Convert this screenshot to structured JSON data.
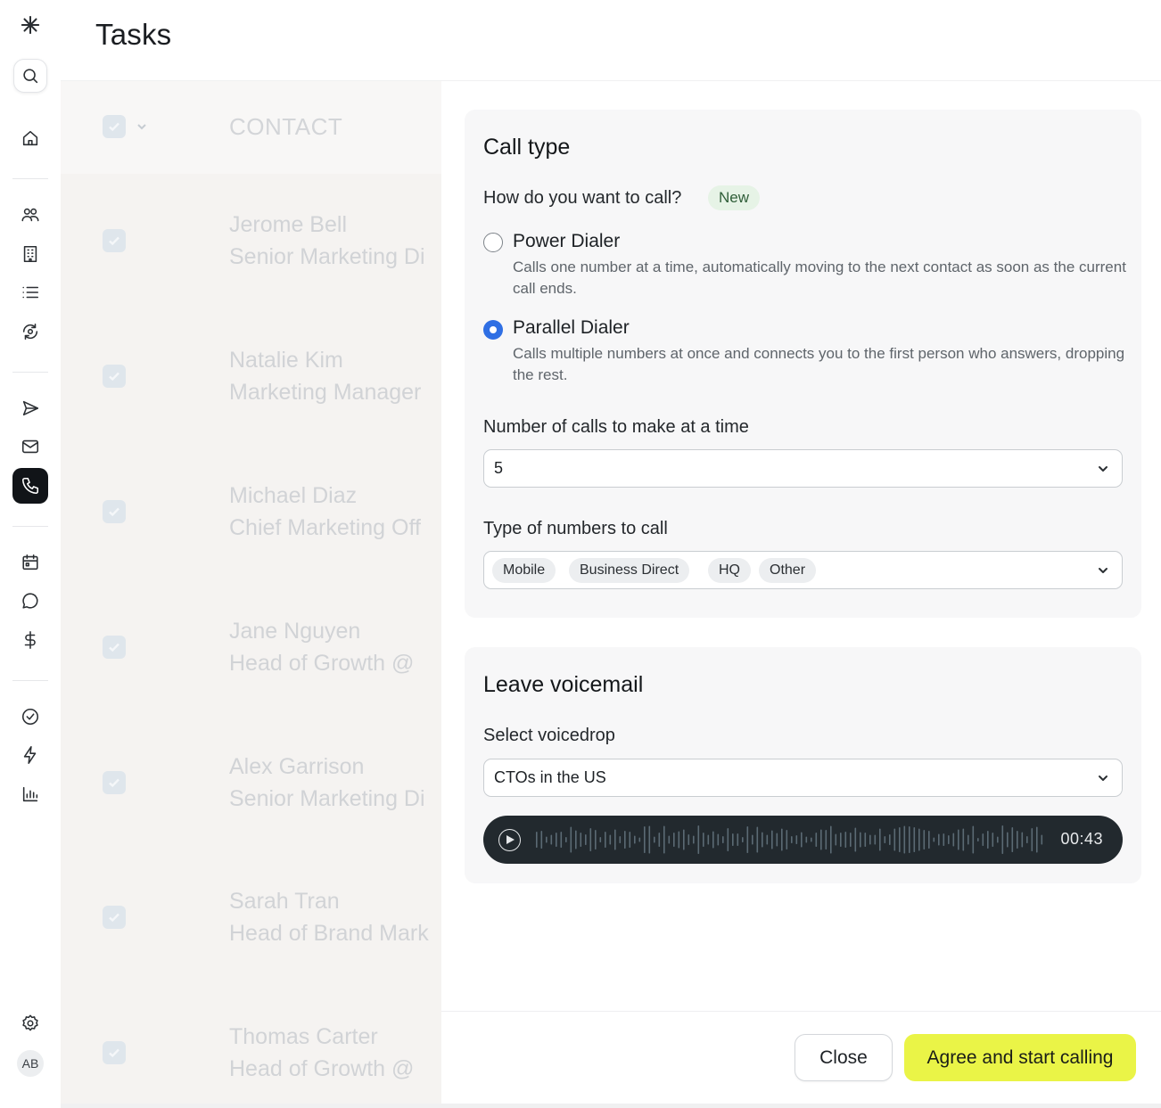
{
  "app": {
    "logo_icon": "asterisk-logo-icon"
  },
  "header": {
    "title": "Tasks"
  },
  "sidebar": {
    "user_initials": "AB",
    "items": [
      {
        "icon": "search-icon"
      },
      {
        "icon": "home-icon"
      },
      {
        "icon": "people-icon"
      },
      {
        "icon": "building-icon"
      },
      {
        "icon": "list-icon"
      },
      {
        "icon": "refresh-eye-icon"
      },
      {
        "icon": "send-icon"
      },
      {
        "icon": "mail-icon"
      },
      {
        "icon": "phone-icon",
        "active": true
      },
      {
        "icon": "calendar-icon"
      },
      {
        "icon": "chat-icon"
      },
      {
        "icon": "dollar-icon"
      },
      {
        "icon": "check-circle-icon"
      },
      {
        "icon": "lightning-icon"
      },
      {
        "icon": "bar-chart-icon"
      },
      {
        "icon": "gear-icon"
      }
    ]
  },
  "list": {
    "column_header": "CONTACT",
    "rows": [
      {
        "name": "Jerome Bell",
        "title": "Senior Marketing Di"
      },
      {
        "name": "Natalie Kim",
        "title": "Marketing Manager"
      },
      {
        "name": "Michael Diaz",
        "title": "Chief Marketing Off"
      },
      {
        "name": "Jane Nguyen",
        "title": "Head of Growth @"
      },
      {
        "name": "Alex Garrison",
        "title": "Senior Marketing Di"
      },
      {
        "name": "Sarah Tran",
        "title": "Head of Brand Mark"
      },
      {
        "name": "Thomas Carter",
        "title": "Head of Growth @"
      }
    ]
  },
  "call_type": {
    "title": "Call type",
    "question": "How do you want to call?",
    "badge": "New",
    "options": [
      {
        "title": "Power Dialer",
        "description": "Calls one number at a time, automatically moving to the next contact as soon as the current call ends.",
        "selected": false
      },
      {
        "title": "Parallel Dialer",
        "description": "Calls multiple numbers at once and connects you to the first person who answers, dropping the rest.",
        "selected": true
      }
    ],
    "calls_label": "Number of calls to make at a time",
    "calls_value": "5",
    "numbers_label": "Type of numbers to call",
    "number_types": [
      "Mobile",
      "Business Direct",
      "HQ",
      "Other"
    ]
  },
  "voicemail": {
    "title": "Leave voicemail",
    "select_label": "Select voicedrop",
    "select_value": "CTOs in the US",
    "duration": "00:43"
  },
  "footer": {
    "close_label": "Close",
    "primary_label": "Agree and start calling"
  },
  "colors": {
    "accent_primary": "#eaf447",
    "radio_selected": "#2f6fe4",
    "badge_bg": "#e6f3e6",
    "audio_bg": "#22292e",
    "sidebar_active": "#111418"
  }
}
